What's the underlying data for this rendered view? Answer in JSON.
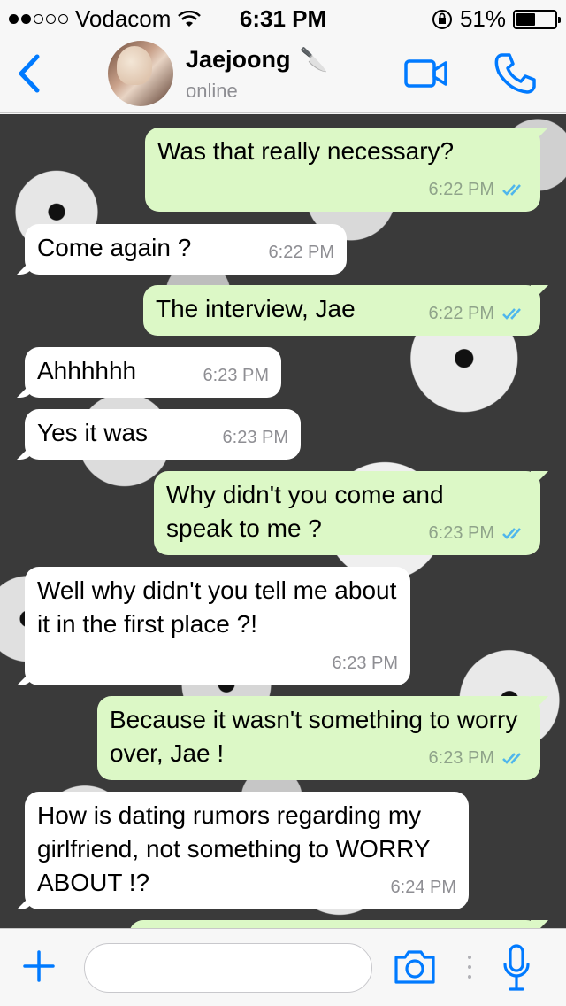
{
  "status_bar": {
    "carrier": "Vodacom",
    "time": "6:31 PM",
    "battery_percent": "51%",
    "battery_level": 0.51,
    "signal_bars_filled": 2,
    "signal_bars_total": 5
  },
  "header": {
    "contact_name": "Jaejoong",
    "name_emoji": "🔪",
    "status": "online"
  },
  "messages": [
    {
      "direction": "out",
      "text": "Was that really necessary?",
      "time": "6:22 PM",
      "read": true
    },
    {
      "direction": "in",
      "text": "Come again ?",
      "time": "6:22 PM"
    },
    {
      "direction": "out",
      "text": "The interview, Jae",
      "time": "6:22 PM",
      "read": true
    },
    {
      "direction": "in",
      "text": "Ahhhhhh",
      "time": "6:23 PM"
    },
    {
      "direction": "in",
      "text": "Yes it was",
      "time": "6:23 PM"
    },
    {
      "direction": "out",
      "text": "Why didn't you come and speak to me ?",
      "time": "6:23 PM",
      "read": true
    },
    {
      "direction": "in",
      "text": "Well why didn't you tell me about it in the first place ?!",
      "time": "6:23 PM"
    },
    {
      "direction": "out",
      "text": "Because it wasn't something to worry over, Jae !",
      "time": "6:23 PM",
      "read": true
    },
    {
      "direction": "in",
      "text": "How is dating rumors regarding my girlfriend, not something to WORRY ABOUT !?",
      "time": "6:24 PM"
    }
  ],
  "input_bar": {
    "placeholder": ""
  },
  "colors": {
    "accent": "#007aff",
    "outgoing_bubble": "#dcf8c6",
    "incoming_bubble": "#ffffff",
    "read_ticks": "#4fb6ec"
  }
}
